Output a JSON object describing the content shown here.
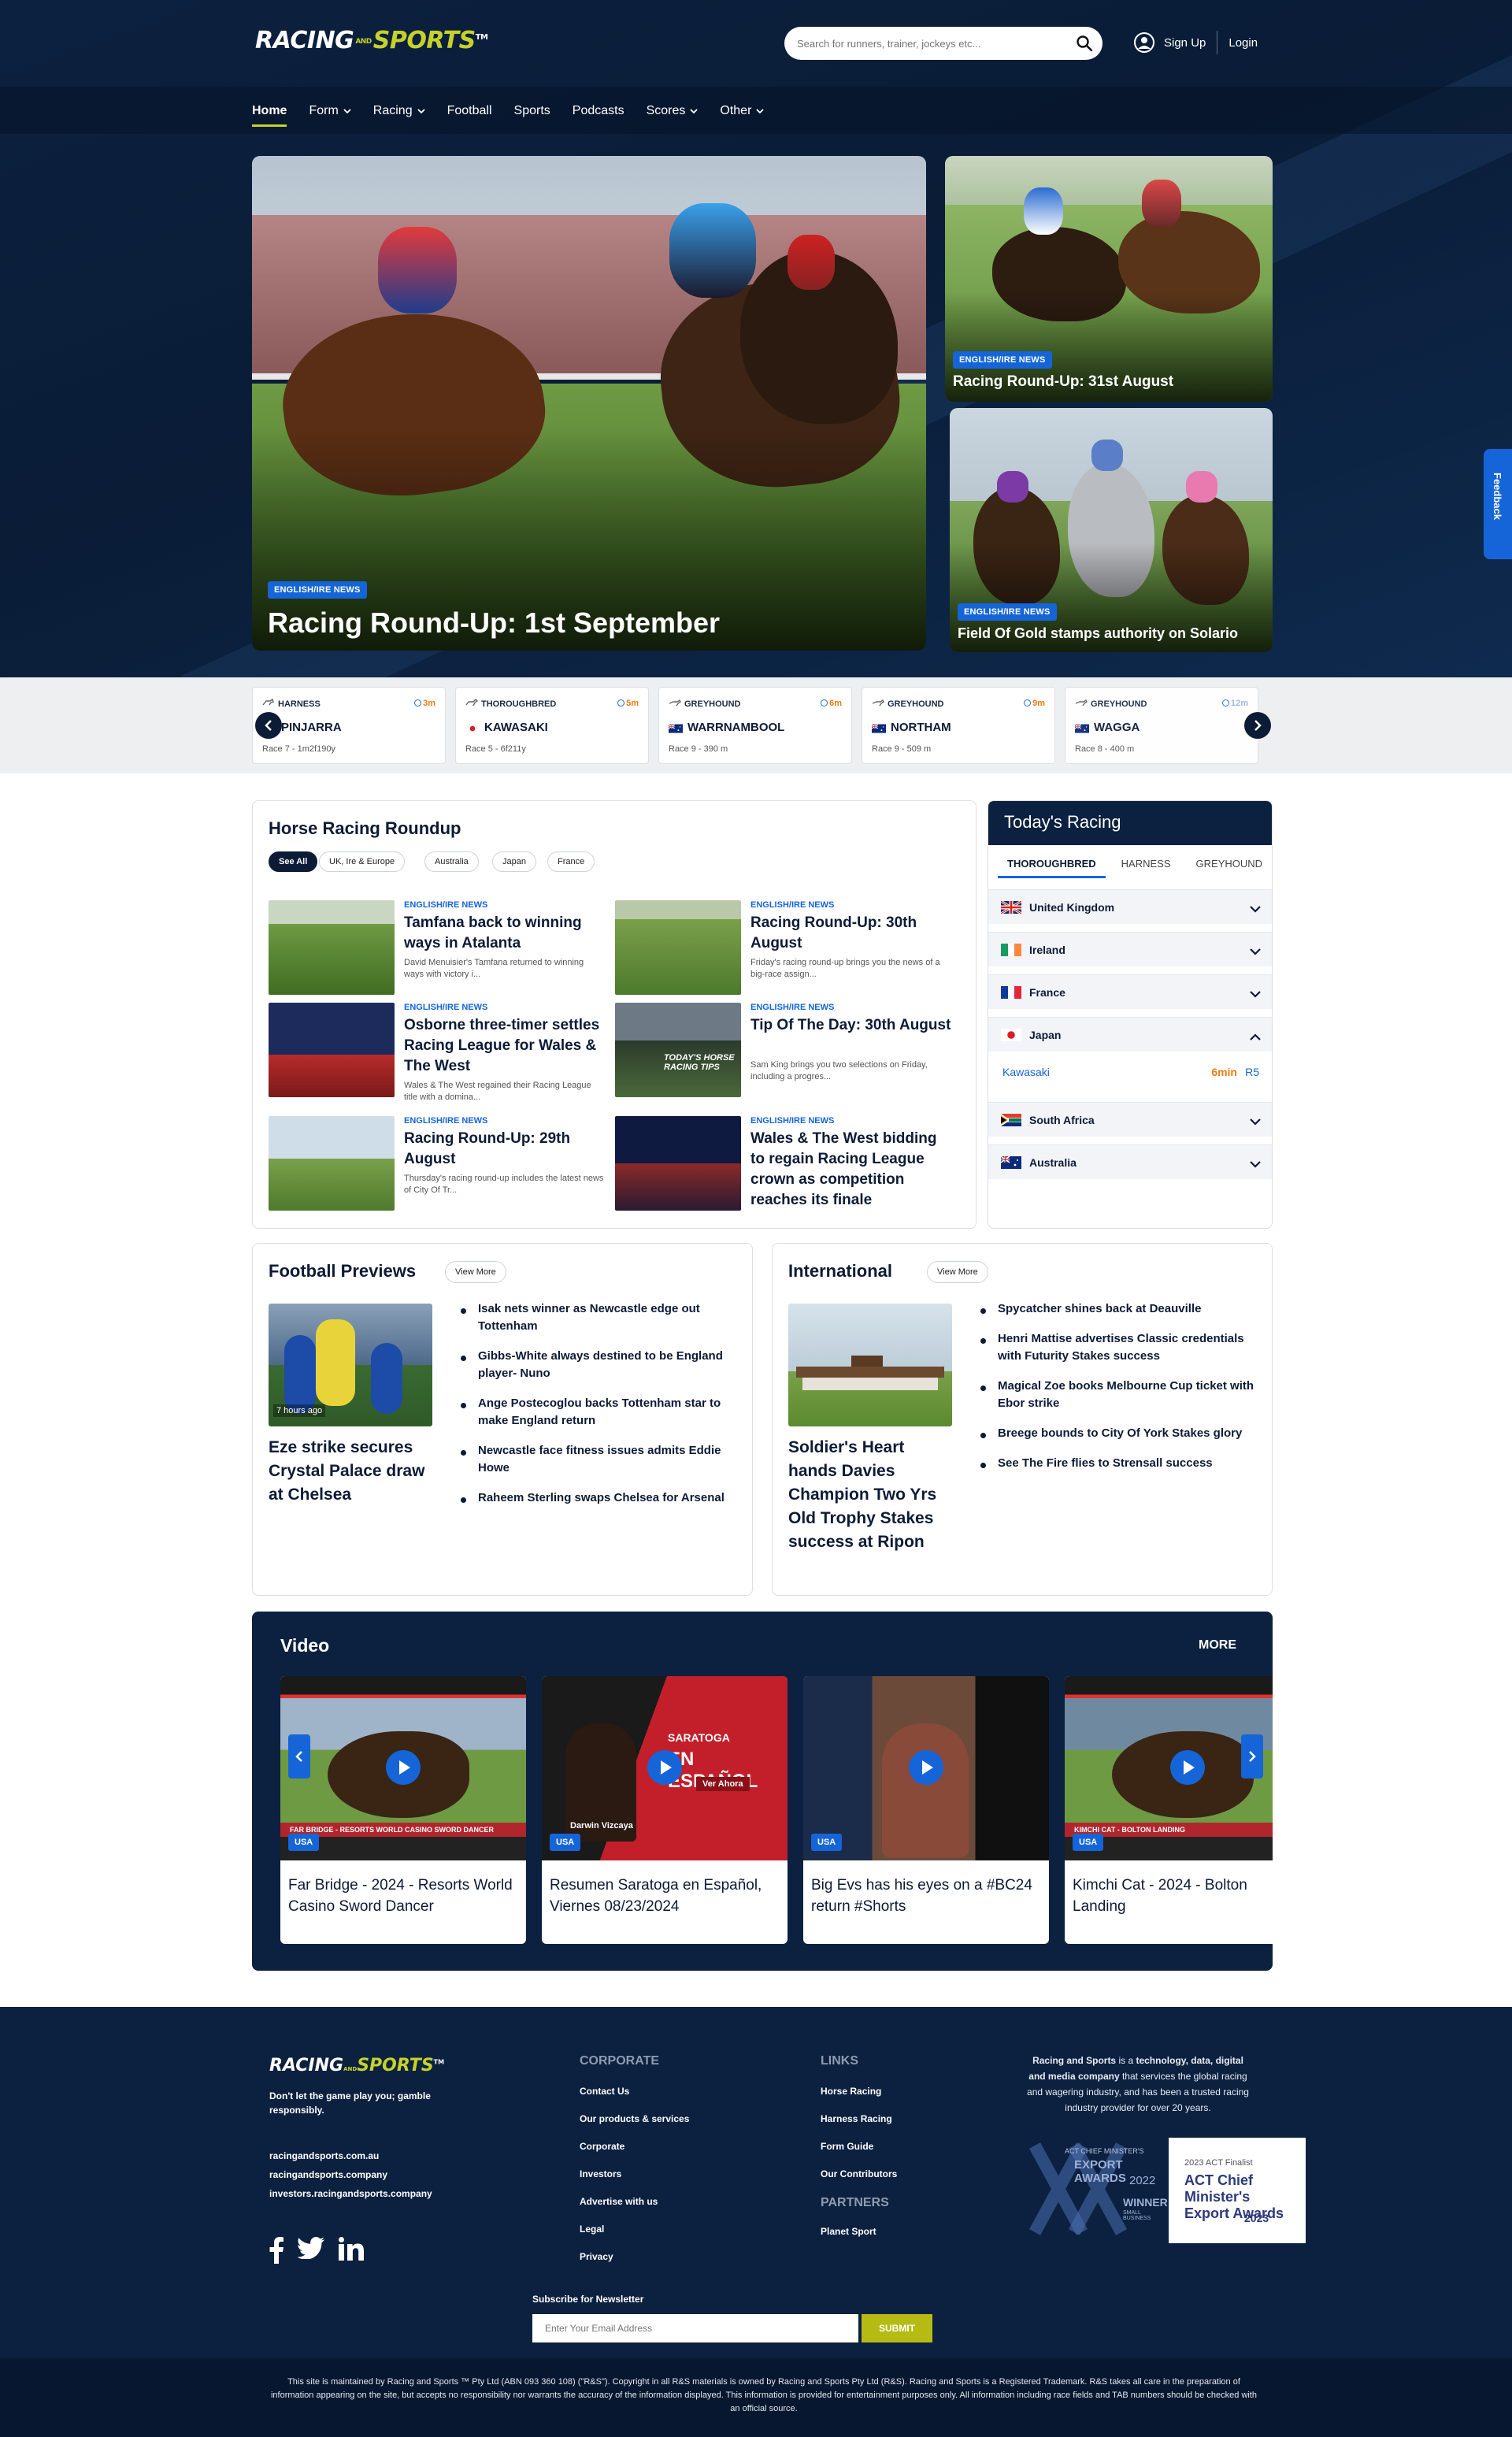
{
  "header": {
    "logo_part1": "RACING",
    "logo_and": "AND",
    "logo_part2": "SPORTS",
    "logo_tm": "TM",
    "search_placeholder": "Search for runners, trainer, jockeys etc...",
    "signup": "Sign Up",
    "login": "Login"
  },
  "nav": [
    {
      "label": "Home",
      "active": true,
      "dropdown": false
    },
    {
      "label": "Form",
      "dropdown": true
    },
    {
      "label": "Racing",
      "dropdown": true
    },
    {
      "label": "Football",
      "dropdown": false
    },
    {
      "label": "Sports",
      "dropdown": false
    },
    {
      "label": "Podcasts",
      "dropdown": false
    },
    {
      "label": "Scores",
      "dropdown": true
    },
    {
      "label": "Other",
      "dropdown": true
    }
  ],
  "hero": {
    "main": {
      "tag": "ENGLISH/IRE NEWS",
      "title": "Racing Round-Up: 1st September"
    },
    "side1": {
      "tag": "ENGLISH/IRE NEWS",
      "title": "Racing Round-Up: 31st August"
    },
    "side2": {
      "tag": "ENGLISH/IRE NEWS",
      "title": "Field Of Gold stamps authority on Solario"
    }
  },
  "feedback": "Feedback",
  "races": [
    {
      "type": "HARNESS",
      "time": "3m",
      "venue": "PINJARRA",
      "flag": "au",
      "desc": "Race 7 - 1m2f190y"
    },
    {
      "type": "THOROUGHBRED",
      "time": "5m",
      "venue": "KAWASAKI",
      "flag": "jp",
      "desc": "Race 5 - 6f211y"
    },
    {
      "type": "GREYHOUND",
      "time": "6m",
      "venue": "WARRNAMBOOL",
      "flag": "au",
      "desc": "Race 9 - 390 m"
    },
    {
      "type": "GREYHOUND",
      "time": "9m",
      "venue": "NORTHAM",
      "flag": "au",
      "desc": "Race 9 - 509 m"
    },
    {
      "type": "GREYHOUND",
      "time": "12m",
      "venue": "WAGGA",
      "flag": "au",
      "desc": "Race 8 - 400 m"
    }
  ],
  "roundup": {
    "title": "Horse Racing Roundup",
    "filters": [
      "See All",
      "UK, Ire & Europe",
      "Australia",
      "Japan",
      "France"
    ],
    "items": [
      {
        "cat": "ENGLISH/IRE NEWS",
        "title": "Tamfana back to winning ways in Atalanta",
        "summary": "David Menuisier's Tamfana returned to winning ways with victory i..."
      },
      {
        "cat": "ENGLISH/IRE NEWS",
        "title": "Racing Round-Up: 30th August",
        "summary": "Friday's racing round-up brings you the news of a big-race assign..."
      },
      {
        "cat": "ENGLISH/IRE NEWS",
        "title": "Osborne three-timer settles Racing League for Wales & The West",
        "summary": "Wales & The West regained their Racing League title with a domina..."
      },
      {
        "cat": "ENGLISH/IRE NEWS",
        "title": "Tip Of The Day: 30th August",
        "summary": "Sam King brings you two selections on Friday, including a progres..."
      },
      {
        "cat": "ENGLISH/IRE NEWS",
        "title": "Racing Round-Up: 29th August",
        "summary": "Thursday's racing round-up includes the latest news of City Of Tr..."
      },
      {
        "cat": "ENGLISH/IRE NEWS",
        "title": "Wales & The West bidding to regain Racing League crown as competition reaches its finale",
        "summary": ""
      }
    ],
    "thumb_text": "TODAY'S HORSE RACING TIPS"
  },
  "today": {
    "title": "Today's Racing",
    "tabs": [
      "THOROUGHBRED",
      "HARNESS",
      "GREYHOUND"
    ],
    "countries": [
      {
        "name": "United Kingdom",
        "flag": "uk",
        "open": false
      },
      {
        "name": "Ireland",
        "flag": "ie",
        "open": false
      },
      {
        "name": "France",
        "flag": "fr",
        "open": false
      },
      {
        "name": "Japan",
        "flag": "jp",
        "open": true
      },
      {
        "name": "South Africa",
        "flag": "za",
        "open": false
      },
      {
        "name": "Australia",
        "flag": "au",
        "open": false
      }
    ],
    "japan_race": {
      "venue": "Kawasaki",
      "time": "6min",
      "race": "R5"
    }
  },
  "football": {
    "title": "Football Previews",
    "view_more": "View More",
    "feature_badge": "7 hours ago",
    "feature_title": "Eze strike secures Crystal Palace draw at Chelsea",
    "bullets": [
      "Isak nets winner as Newcastle edge out Tottenham",
      "Gibbs-White always destined to be England player- Nuno",
      "Ange Postecoglou backs Tottenham star to make England return",
      "Newcastle face fitness issues admits Eddie Howe",
      "Raheem Sterling swaps Chelsea for Arsenal"
    ]
  },
  "international": {
    "title": "International",
    "view_more": "View More",
    "feature_title": "Soldier's Heart hands Davies Champion Two Yrs Old Trophy Stakes success at Ripon",
    "bullets": [
      "Spycatcher shines back at Deauville",
      "Henri Mattise advertises Classic credentials with Futurity Stakes success",
      "Magical Zoe books Melbourne Cup ticket with Ebor strike",
      "Breege bounds to City Of York Stakes glory",
      "See The Fire flies to Strensall success"
    ]
  },
  "video": {
    "title": "Video",
    "more": "MORE",
    "items": [
      {
        "badge": "USA",
        "title": "Far Bridge - 2024 - Resorts World Casino Sword Dancer",
        "caption": "FAR BRIDGE - RESORTS WORLD CASINO SWORD DANCER"
      },
      {
        "badge": "USA",
        "title": "Resumen Saratoga en Español, Viernes 08/23/2024",
        "caption": "Darwin Vizcaya",
        "overlay1": "SARATOGA",
        "overlay2": "EN ESPAÑOL",
        "overlay3": "Ver Ahora"
      },
      {
        "badge": "USA",
        "title": "Big Evs has his eyes on a #BC24 return #Shorts",
        "caption": ""
      },
      {
        "badge": "USA",
        "title": "Kimchi Cat - 2024 - Bolton Landing",
        "caption": "KIMCHI CAT - BOLTON LANDING"
      }
    ]
  },
  "footer": {
    "logo_part1": "RACING",
    "logo_and": "AND",
    "logo_part2": "SPORTS",
    "logo_tm": "TM",
    "responsible": "Don't let the game play you; gamble responsibly.",
    "sites": [
      "racingandsports.com.au",
      "racingandsports.company",
      "investors.racingandsports.company"
    ],
    "corporate_heading": "CORPORATE",
    "corporate": [
      "Contact Us",
      "Our products & services",
      "Corporate",
      "Investors",
      "Advertise with us",
      "Legal",
      "Privacy"
    ],
    "links_heading": "LINKS",
    "links": [
      "Horse Racing",
      "Harness Racing",
      "Form Guide",
      "Our Contributors"
    ],
    "partners_heading": "PARTNERS",
    "partners": [
      "Planet Sport"
    ],
    "about_bold1": "Racing and Sports",
    "about_text1": " is a ",
    "about_bold2": "technology, data, digital and media company",
    "about_text2": " that services the global racing and wagering industry, and has been a trusted racing industry provider for over 20 years.",
    "award1_line1": "ACT CHIEF MINISTER'S",
    "award1_line2": "EXPORT AWARDS",
    "award1_line3": "2022",
    "award1_line4": "WINNER",
    "award1_line5": "SMALL BUSINESS",
    "award2_line1": "2023 ACT Finalist",
    "award2_line2": "ACT Chief Minister's Export Awards",
    "award2_line3": "2023",
    "newsletter_label": "Subscribe for Newsletter",
    "newsletter_placeholder": "Enter Your Email Address",
    "newsletter_button": "SUBMIT",
    "legal": "This site is maintained by Racing and Sports ™ Pty Ltd (ABN 093 360 108) (\"R&S\"). Copyright in all R&S materials is owned by Racing and Sports Pty Ltd (R&S). Racing and Sports is a Registered Trademark. R&S takes all care in the preparation of information appearing on the site, but accepts no responsibility nor warrants the accuracy of the information displayed. This information is provided for entertainment purposes only. All information including race fields and TAB numbers should be checked with an official source."
  },
  "colors": {
    "navy": "#0c2140",
    "accent": "#c6d22a",
    "blue": "#1565d8",
    "orange": "#ee7a12"
  }
}
